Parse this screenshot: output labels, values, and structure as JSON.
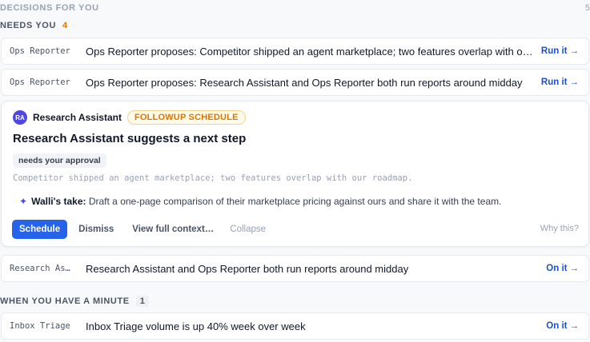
{
  "header": {
    "title": "DECISIONS FOR YOU",
    "count": "5"
  },
  "needs_you": {
    "label": "NEEDS YOU",
    "count": "4",
    "rows": [
      {
        "source": "Ops Reporter",
        "text": "Ops Reporter proposes: Competitor shipped an agent marketplace; two features overlap with our roadmap",
        "action": "Run it",
        "arrow": "→"
      },
      {
        "source": "Ops Reporter",
        "text": "Ops Reporter proposes: Research Assistant and Ops Reporter both run reports around midday",
        "action": "Run it",
        "arrow": "→"
      }
    ],
    "expanded": {
      "avatar": "RA",
      "agent": "Research Assistant",
      "tag": "FOLLOWUP SCHEDULE",
      "title": "Research Assistant suggests a next step",
      "badge": "needs your approval",
      "context": "Competitor shipped an agent marketplace; two features overlap with our roadmap.",
      "take_icon": "✦",
      "take_label": "Walli's take:",
      "take_text": "Draft a one-page comparison of their marketplace pricing against ours and share it with the team.",
      "buttons": {
        "primary": "Schedule",
        "dismiss": "Dismiss",
        "context": "View full context…",
        "collapse": "Collapse"
      },
      "why": "Why this?"
    },
    "row_after": {
      "source": "Research Assistant",
      "source_display": "Research As…",
      "text": "Research Assistant and Ops Reporter both run reports around midday",
      "action": "On it",
      "arrow": "→"
    }
  },
  "when_minute": {
    "label": "WHEN YOU HAVE A MINUTE",
    "count": "1",
    "rows": [
      {
        "source": "Inbox Triage",
        "text": "Inbox Triage volume is up 40% week over week",
        "action": "On it",
        "arrow": "→"
      }
    ]
  },
  "colors": {
    "accent": "#2563eb",
    "warning": "#d97706",
    "avatar": "#4f46e5"
  }
}
